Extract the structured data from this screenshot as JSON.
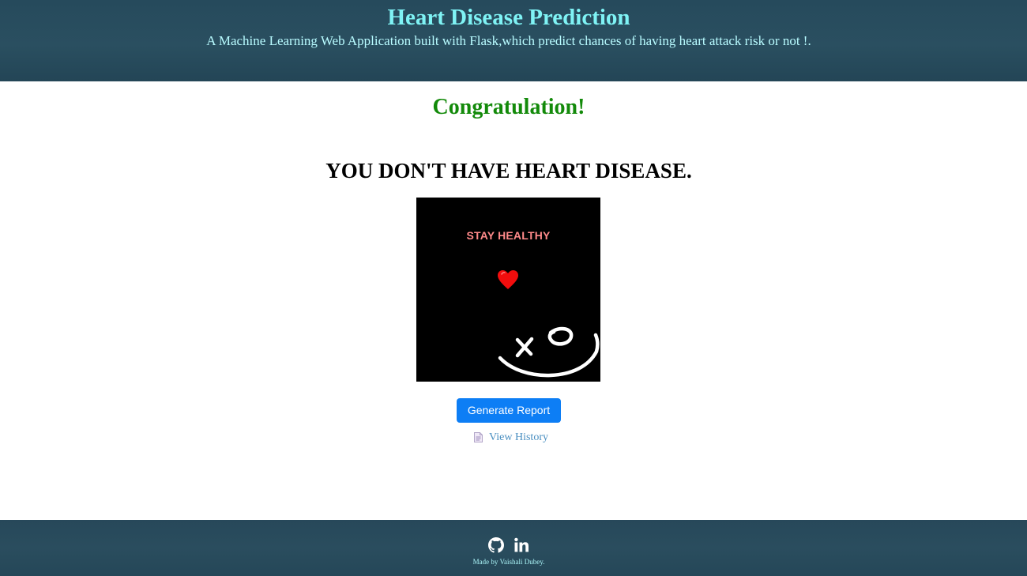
{
  "header": {
    "title": "Heart Disease Prediction",
    "subtitle": "A Machine Learning Web Application built with Flask,which predict chances of having heart attack risk or not !."
  },
  "main": {
    "congrats": "Congratulation!",
    "result": "YOU DON'T HAVE HEART DISEASE.",
    "image": {
      "text": "STAY HEALTHY",
      "icon": "heart-icon"
    },
    "generate_button": "Generate Report",
    "history_link": "View History",
    "history_icon": "document-icon"
  },
  "footer": {
    "icons": [
      "github-icon",
      "linkedin-icon"
    ],
    "credit": "Made by Vaishali Dubey."
  },
  "colors": {
    "header_bg": "#264a5c",
    "title": "#7ff3f5",
    "congrats": "#138a0a",
    "button": "#0d7ef5",
    "link": "#4a8fc1"
  }
}
